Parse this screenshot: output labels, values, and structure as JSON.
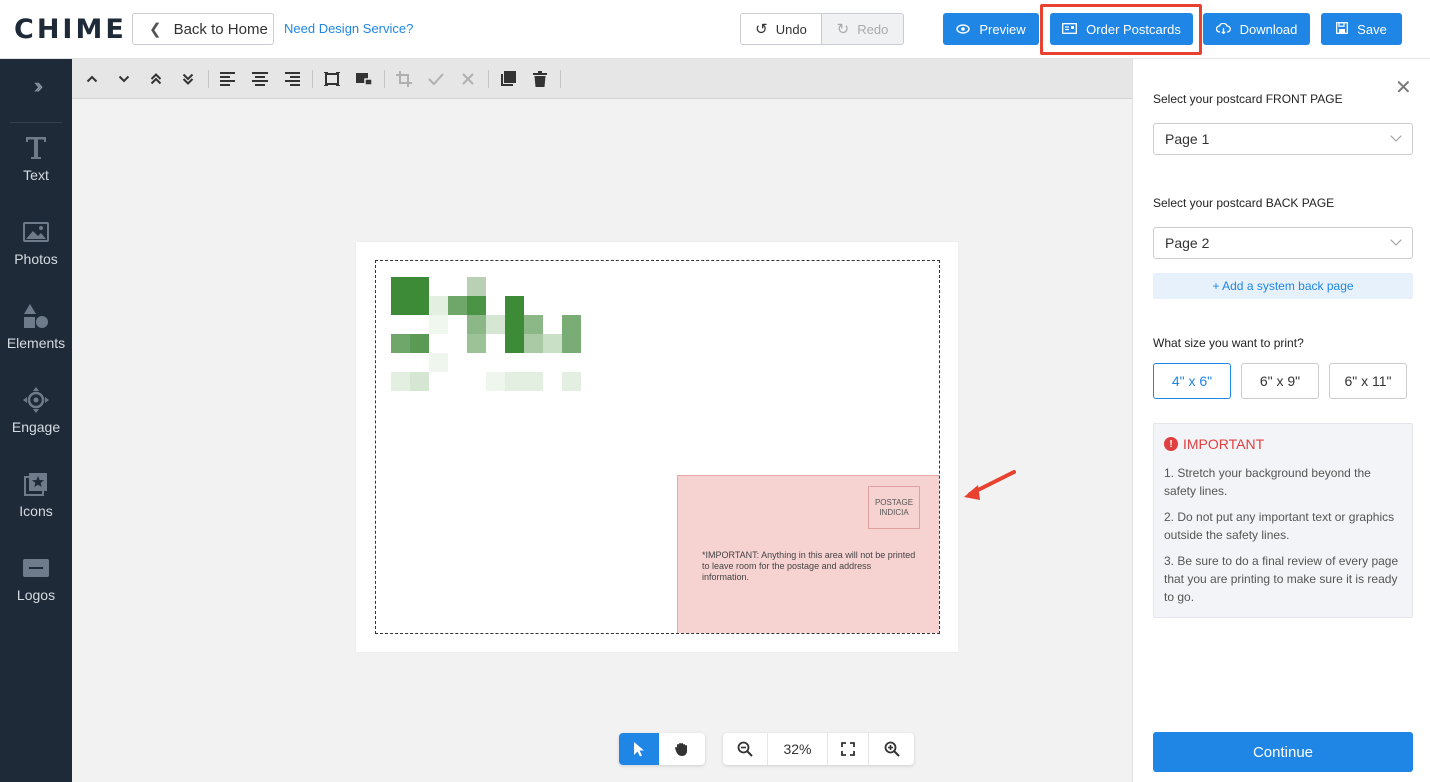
{
  "colors": {
    "accent": "#1f86e6",
    "sidebar_bg": "#1e2a38",
    "highlight": "#e8412f",
    "safety_zone": "#f6d2d1",
    "warning": "#e04040"
  },
  "header": {
    "logo": "CHIME",
    "back_label": "Back to Home",
    "design_link": "Need Design Service?",
    "undo_label": "Undo",
    "redo_label": "Redo",
    "preview_label": "Preview",
    "order_label": "Order Postcards",
    "download_label": "Download",
    "save_label": "Save"
  },
  "sidebar": {
    "items": [
      {
        "label": "Text",
        "icon": "text-icon"
      },
      {
        "label": "Photos",
        "icon": "photo-icon"
      },
      {
        "label": "Elements",
        "icon": "shapes-icon"
      },
      {
        "label": "Engage",
        "icon": "engage-icon"
      },
      {
        "label": "Icons",
        "icon": "icon-library-icon"
      },
      {
        "label": "Logos",
        "icon": "logo-icon"
      }
    ]
  },
  "toolbar": {
    "icons": [
      "move-up-icon",
      "move-down-icon",
      "move-top-icon",
      "move-bottom-icon",
      "align-left-icon",
      "align-center-icon",
      "align-right-icon",
      "fit-frame-icon",
      "replace-image-icon",
      "crop-icon",
      "confirm-icon",
      "cancel-icon",
      "duplicate-icon",
      "delete-icon"
    ]
  },
  "canvas": {
    "indicia_line1": "POSTAGE",
    "indicia_line2": "INDICIA",
    "address_note": "*IMPORTANT: Anything in this area will not be printed to leave room for the postage and address information."
  },
  "zoom": {
    "value": "32%"
  },
  "panel": {
    "front_label": "Select your postcard FRONT PAGE",
    "front_value": "Page 1",
    "back_label": "Select your postcard BACK PAGE",
    "back_value": "Page 2",
    "add_back_label": "+ Add a system back page",
    "size_label": "What size you want to print?",
    "sizes": [
      "4\" x 6\"",
      "6\" x 9\"",
      "6\" x 11\""
    ],
    "selected_size": "4\" x 6\"",
    "important_title": "IMPORTANT",
    "important_items": [
      "1. Stretch your background beyond the safety lines.",
      "2. Do not put any important text or graphics outside the safety lines.",
      "3. Be sure to do a final review of every page that you are printing to make sure it is ready to go."
    ],
    "continue_label": "Continue"
  }
}
